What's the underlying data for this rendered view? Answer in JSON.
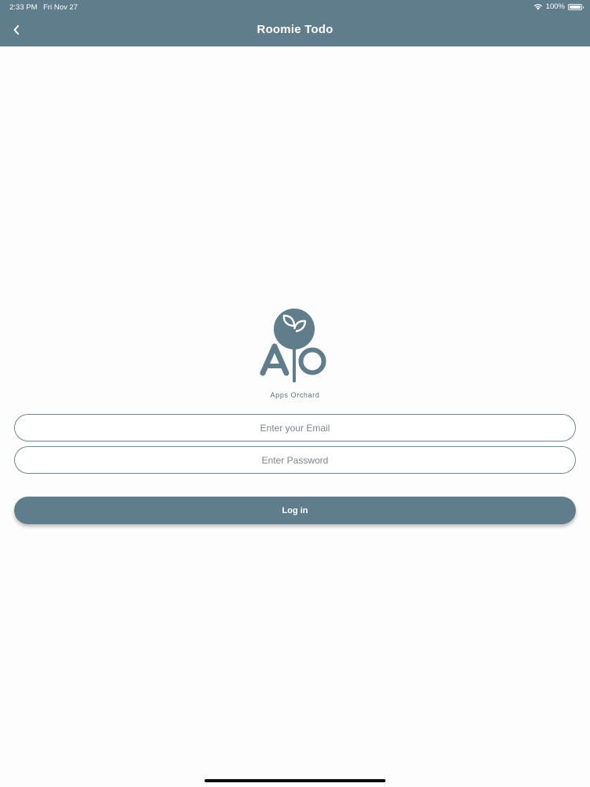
{
  "status_bar": {
    "time": "2:33 PM",
    "date": "Fri Nov 27",
    "battery": "100%",
    "icons": [
      "wifi-icon",
      "battery-icon"
    ]
  },
  "nav": {
    "title": "Roomie Todo",
    "back_icon": "chevron-left-icon"
  },
  "logo": {
    "caption": "Apps Orchard",
    "mark_text": "AO",
    "color": "#607d8b"
  },
  "form": {
    "email_placeholder": "Enter your Email",
    "email_value": "",
    "password_placeholder": "Enter Password",
    "password_value": "",
    "login_label": "Log in"
  },
  "colors": {
    "accent": "#607d8b",
    "background": "#fdfdfd"
  }
}
